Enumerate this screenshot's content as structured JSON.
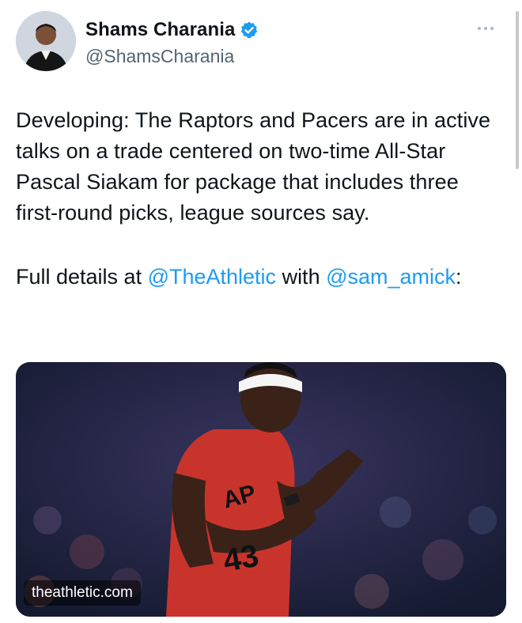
{
  "author": {
    "name": "Shams Charania",
    "handle": "@ShamsCharania",
    "verified": true,
    "verified_color": "#1d9bf0"
  },
  "tweet": {
    "text": "Developing: The Raptors and Pacers are in active talks on a trade centered on two-time All-Star Pascal Siakam for package that includes three first-round picks, league sources say.",
    "details_prefix": "Full details at ",
    "mention_1": "@TheAthletic",
    "details_middle": " with ",
    "mention_2": "@sam_amick",
    "details_suffix": ":"
  },
  "media": {
    "domain": "theathletic.com"
  },
  "colors": {
    "link": "#1d9bf0",
    "text": "#0f1419",
    "secondary": "#536471"
  },
  "icons": {
    "more": "more-horizontal-icon",
    "verified": "verified-badge-icon"
  }
}
